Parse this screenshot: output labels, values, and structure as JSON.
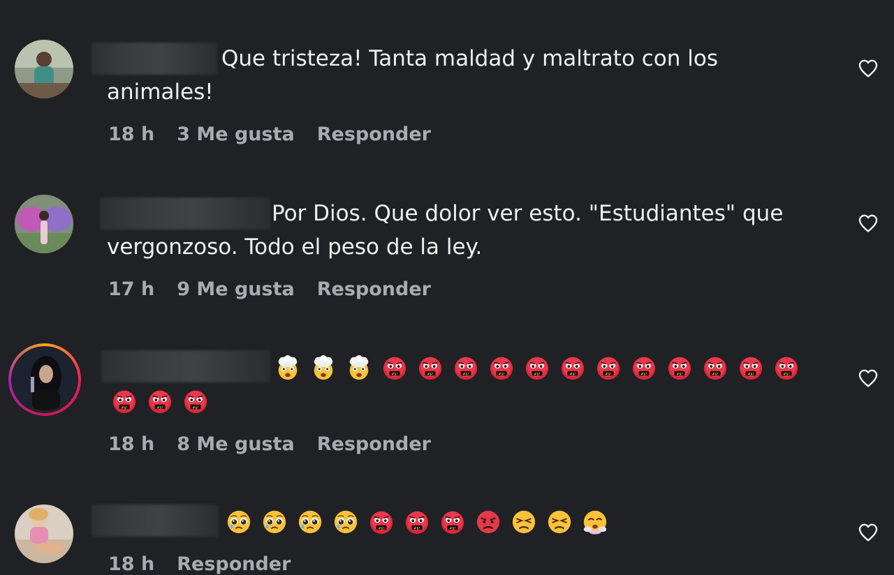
{
  "comments": [
    {
      "text_line1": "Que tristeza! Tanta maldad y maltrato con los",
      "text_line2": "animales!",
      "time": "18 h",
      "likes": "3 Me gusta",
      "reply": "Responder"
    },
    {
      "text_line1": "Por Dios. Que dolor ver esto. \"Estudiantes\" que",
      "text_line2": "vergonzoso. Todo el peso de la ley.",
      "time": "17 h",
      "likes": "9 Me gusta",
      "reply": "Responder"
    },
    {
      "emojis_line1": [
        "exploding-head",
        "exploding-head",
        "exploding-head",
        "cursing-face",
        "cursing-face",
        "cursing-face",
        "cursing-face",
        "cursing-face",
        "cursing-face",
        "cursing-face",
        "cursing-face",
        "cursing-face",
        "cursing-face",
        "cursing-face",
        "cursing-face"
      ],
      "emojis_line2": [
        "cursing-face",
        "cursing-face",
        "cursing-face"
      ],
      "time": "18 h",
      "likes": "8 Me gusta",
      "reply": "Responder"
    },
    {
      "emojis_line1": [
        "pleading-face",
        "pleading-face",
        "pleading-face",
        "pleading-face",
        "cursing-face",
        "cursing-face",
        "cursing-face",
        "angry-face",
        "persevering-face",
        "persevering-face",
        "face-with-steam"
      ],
      "time": "18 h",
      "reply": "Responder"
    }
  ],
  "icons": {
    "like": "heart-outline-icon"
  },
  "colors": {
    "background": "#202124",
    "text": "#f0f0f0",
    "meta": "#a8abb2"
  }
}
